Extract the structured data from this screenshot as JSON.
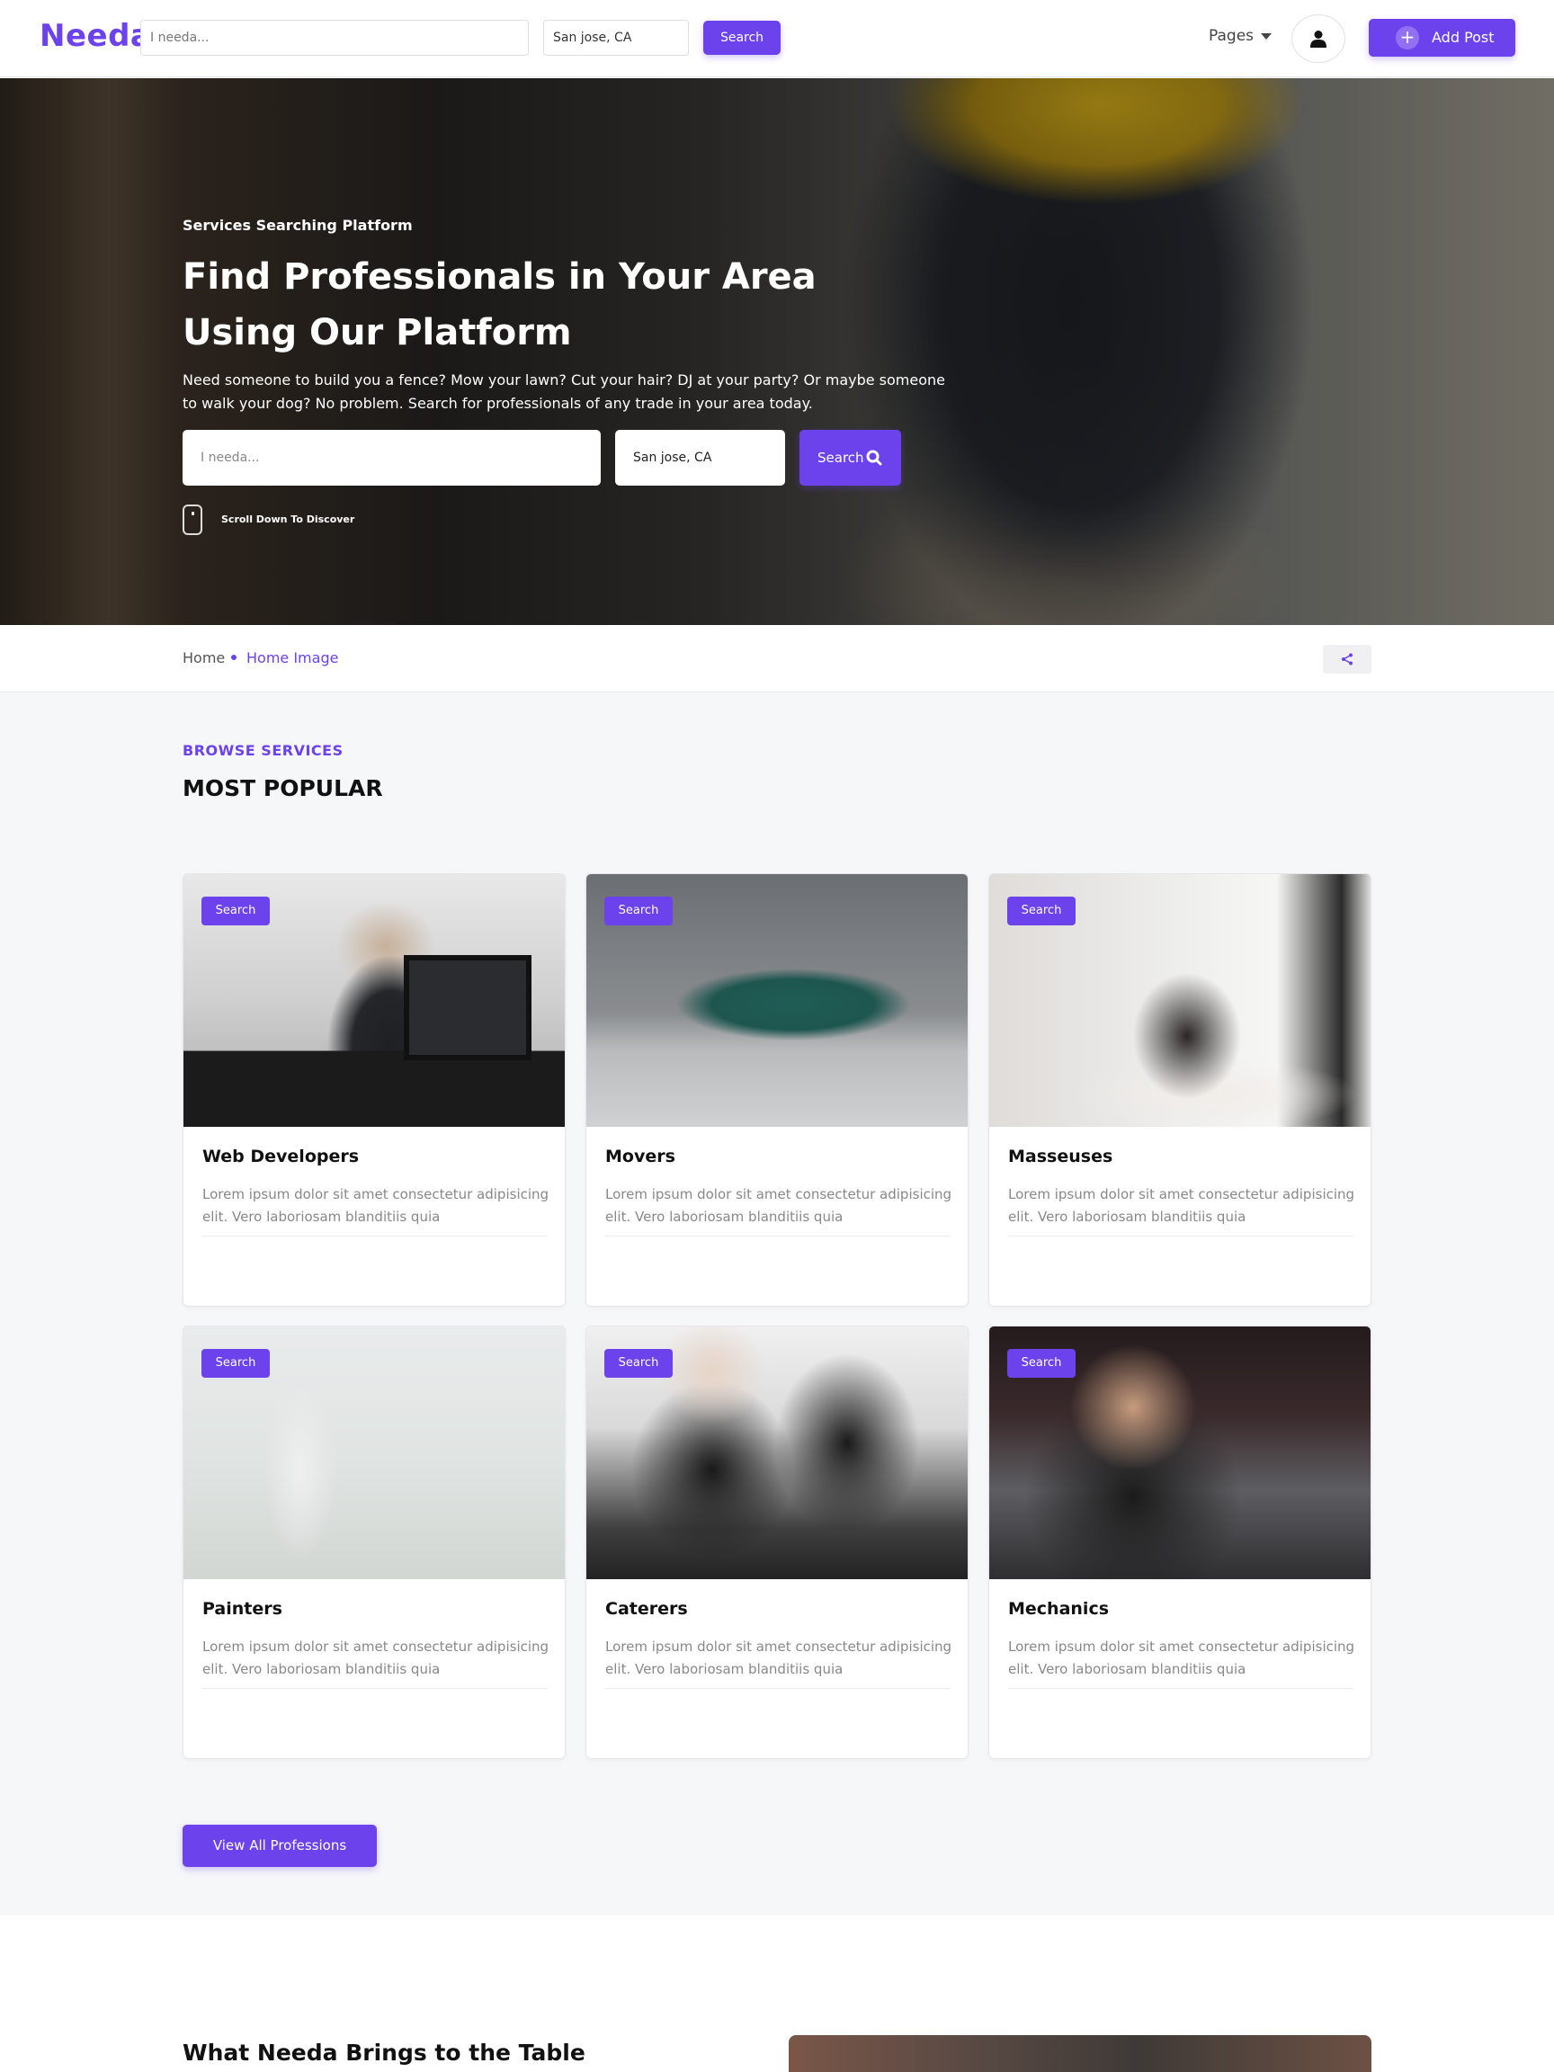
{
  "header": {
    "logo": "Needa",
    "search_placeholder": "I needa...",
    "location_value": "San jose, CA",
    "search_label": "Search",
    "pages_label": "Pages",
    "add_post_label": "Add Post"
  },
  "hero": {
    "kicker": "Services Searching Platform",
    "title": "Find Professionals in Your Area Using Our Platform",
    "description": "Need someone to build you a fence? Mow your lawn? Cut your hair? DJ at your party? Or maybe someone to walk your dog? No problem. Search for professionals of any trade in your area today.",
    "search_placeholder": "I needa...",
    "location_value": "San jose, CA",
    "search_label": "Search",
    "scroll_text": "Scroll Down To Discover"
  },
  "breadcrumb": {
    "home": "Home",
    "current": "Home Image"
  },
  "section": {
    "kicker": "BROWSE SERVICES",
    "title": "MOST POPULAR",
    "cards": [
      {
        "badge": "Search",
        "title": "Web Developers",
        "description": "Lorem ipsum dolor sit amet consectetur adipisicing elit. Vero laboriosam blanditiis quia"
      },
      {
        "badge": "Search",
        "title": "Movers",
        "description": "Lorem ipsum dolor sit amet consectetur adipisicing elit. Vero laboriosam blanditiis quia"
      },
      {
        "badge": "Search",
        "title": "Masseuses",
        "description": "Lorem ipsum dolor sit amet consectetur adipisicing elit. Vero laboriosam blanditiis quia"
      },
      {
        "badge": "Search",
        "title": "Painters",
        "description": "Lorem ipsum dolor sit amet consectetur adipisicing elit. Vero laboriosam blanditiis quia"
      },
      {
        "badge": "Search",
        "title": "Caterers",
        "description": "Lorem ipsum dolor sit amet consectetur adipisicing elit. Vero laboriosam blanditiis quia"
      },
      {
        "badge": "Search",
        "title": "Mechanics",
        "description": "Lorem ipsum dolor sit amet consectetur adipisicing elit. Vero laboriosam blanditiis quia"
      }
    ],
    "view_all_label": "View All Professions"
  },
  "bottom": {
    "title": "What Needa Brings to the Table"
  },
  "colors": {
    "accent": "#6c42ec",
    "page_bg": "#f6f7f9"
  },
  "icons": [
    "user-icon",
    "plus-icon",
    "caret-down-icon",
    "search-icon",
    "mouse-icon",
    "share-icon"
  ]
}
